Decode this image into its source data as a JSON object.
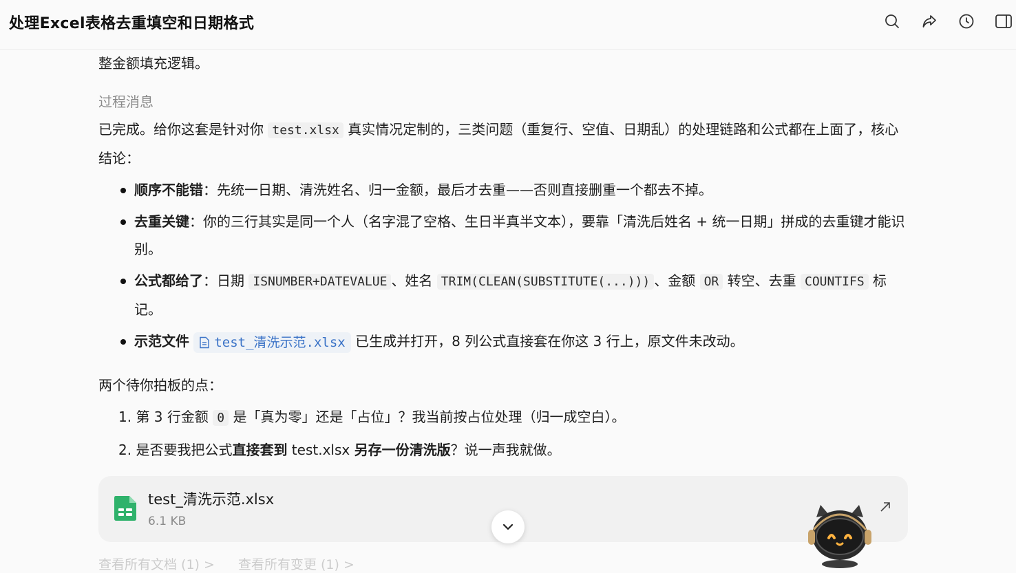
{
  "header": {
    "title": "处理Excel表格去重填空和日期格式",
    "icons": [
      "search-icon",
      "share-icon",
      "history-icon",
      "sidebar-icon"
    ]
  },
  "main": {
    "intro_tail": "整金额填充逻辑。",
    "process_label": "过程消息",
    "summary_a": "已完成。给你这套是针对你 ",
    "summary_code": "test.xlsx",
    "summary_b": " 真实情况定制的，三类问题（重复行、空值、日期乱）的处理链路和公式都在上面了，核心结论：",
    "bullets": {
      "b1_bold": "顺序不能错",
      "b1_text": "：先统一日期、清洗姓名、归一金额，最后才去重——否则直接删重一个都去不掉。",
      "b2_bold": "去重关键",
      "b2_text": "：你的三行其实是同一个人（名字混了空格、生日半真半文本），要靠「清洗后姓名 + 统一日期」拼成的去重键才能识别。",
      "b3_bold": "公式都给了",
      "b3_t1": "：日期 ",
      "b3_c1": "ISNUMBER+DATEVALUE",
      "b3_t2": "、姓名 ",
      "b3_c2": "TRIM(CLEAN(SUBSTITUTE(...)))",
      "b3_t3": "、金额 ",
      "b3_c3": "OR",
      "b3_t4": " 转空、去重 ",
      "b3_c4": "COUNTIFS",
      "b3_t5": " 标记。",
      "b4_bold": "示范文件",
      "b4_file": "test_清洗示范.xlsx",
      "b4_text": " 已生成并打开，8 列公式直接套在你这 3 行上，原文件未改动。"
    },
    "pending_title": "两个待你拍板的点：",
    "ordered": {
      "o1_a": "1. 第 3 行金额 ",
      "o1_code": "0",
      "o1_b": " 是「真为零」还是「占位」？我当前按占位处理（归一成空白）。",
      "o2_a": "2. 是否要我把公式",
      "o2_bold1": "直接套到",
      "o2_b": " test.xlsx ",
      "o2_bold2": "另存一份清洗版",
      "o2_c": "？说一声我就做。"
    }
  },
  "attachment": {
    "name": "test_清洗示范.xlsx",
    "size": "6.1 KB",
    "icon": "spreadsheet-icon"
  },
  "footer": {
    "link1": "查看所有文档 (1) >",
    "link2": "查看所有变更 (1) >"
  },
  "colors": {
    "accent": "#3b73c7",
    "file_green": "#2fb26b"
  }
}
